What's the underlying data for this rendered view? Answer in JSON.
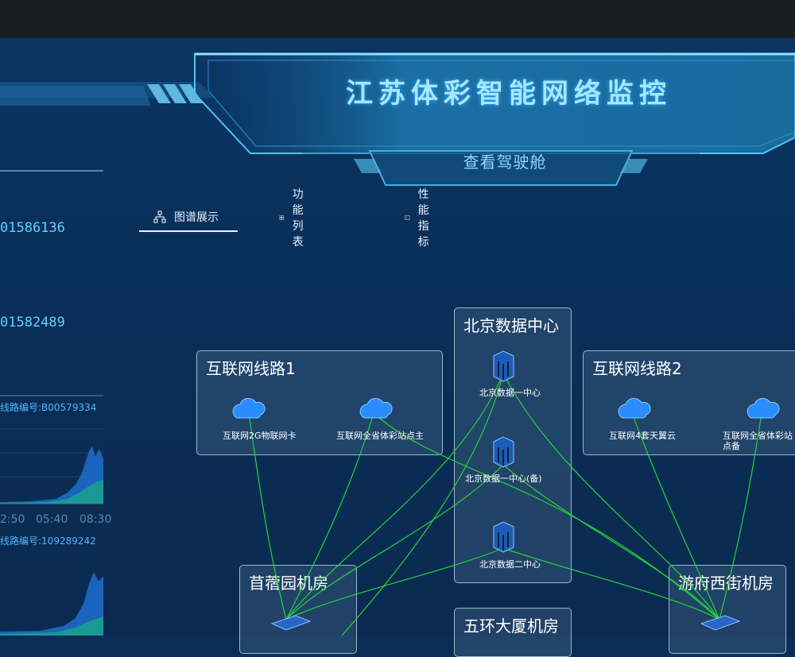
{
  "header": {
    "title": "江苏体彩智能网络监控",
    "subtitle": "查看驾驶舱"
  },
  "left_panel": {
    "value1": "01586136",
    "value2": "01582489",
    "line1_label": "线路编号:B00579334",
    "line2_label": "线路编号:109289242",
    "x_ticks": [
      "2:50",
      "05:40",
      "08:30"
    ]
  },
  "tabs": [
    {
      "label": "图谱展示",
      "icon": "topology-icon",
      "active": true
    },
    {
      "label": "功能列表",
      "icon": "grid-icon",
      "active": false
    },
    {
      "label": "性能指标",
      "icon": "terminal-icon",
      "active": false
    }
  ],
  "topology": {
    "groups": {
      "internet1": {
        "title": "互联网线路1",
        "nodes": [
          "互联网2G物联网卡",
          "互联网全省体彩站点主"
        ]
      },
      "beijing": {
        "title": "北京数据中心",
        "nodes": [
          "北京数据一中心",
          "北京数据一中心(备)",
          "北京数据二中心"
        ]
      },
      "internet2": {
        "title": "互联网线路2",
        "nodes": [
          "互联网4套天翼云",
          "互联网全省体彩站点备"
        ]
      },
      "muxu": {
        "title": "苜蓿园机房"
      },
      "wuhuan": {
        "title": "五环大厦机房"
      },
      "youfu": {
        "title": "游府西街机房"
      }
    }
  },
  "colors": {
    "link": "#22d43a",
    "accent": "#5fd0ff",
    "title_glow": "#2aa9ff"
  }
}
